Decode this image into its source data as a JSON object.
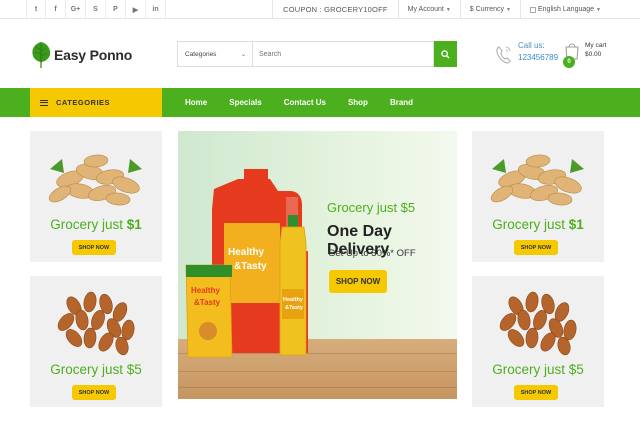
{
  "topbar": {
    "social": [
      "t",
      "f",
      "G+",
      "S",
      "P",
      "▶",
      "in"
    ],
    "coupon": "COUPON : GROCERY10OFF",
    "account": "My Account",
    "currency": "$ Currency",
    "language": "English Language"
  },
  "header": {
    "logo": "Easy Ponno",
    "search": {
      "category": "Categories",
      "placeholder": "Search"
    },
    "call_label": "Call us:",
    "call_number": "123456789",
    "cart_label": "My cart",
    "cart_amount": "$0.00",
    "cart_count": "0"
  },
  "nav": {
    "categories_label": "CATEGORIES",
    "links": [
      "Home",
      "Specials",
      "Contact Us",
      "Shop",
      "Brand"
    ]
  },
  "promos": {
    "left_top": {
      "title": "Grocery just ",
      "price": "$1",
      "button": "SHOP NOW"
    },
    "left_bottom": {
      "title": "Grocery just $5",
      "button": "SHOP NOW"
    },
    "right_top": {
      "title": "Grocery just ",
      "price": "$1",
      "button": "SHOP NOW"
    },
    "right_bottom": {
      "title": "Grocery just $5",
      "button": "SHOP NOW"
    }
  },
  "banner": {
    "subtitle": "Grocery just $5",
    "title": "One Day Delivery",
    "offer": "Get Up to 30%* OFF",
    "button": "SHOP NOW",
    "product_text": "Healthy & Tasty"
  },
  "colors": {
    "green": "#4caf1d",
    "yellow": "#f5c800",
    "card_bg": "#f0f0f0"
  }
}
